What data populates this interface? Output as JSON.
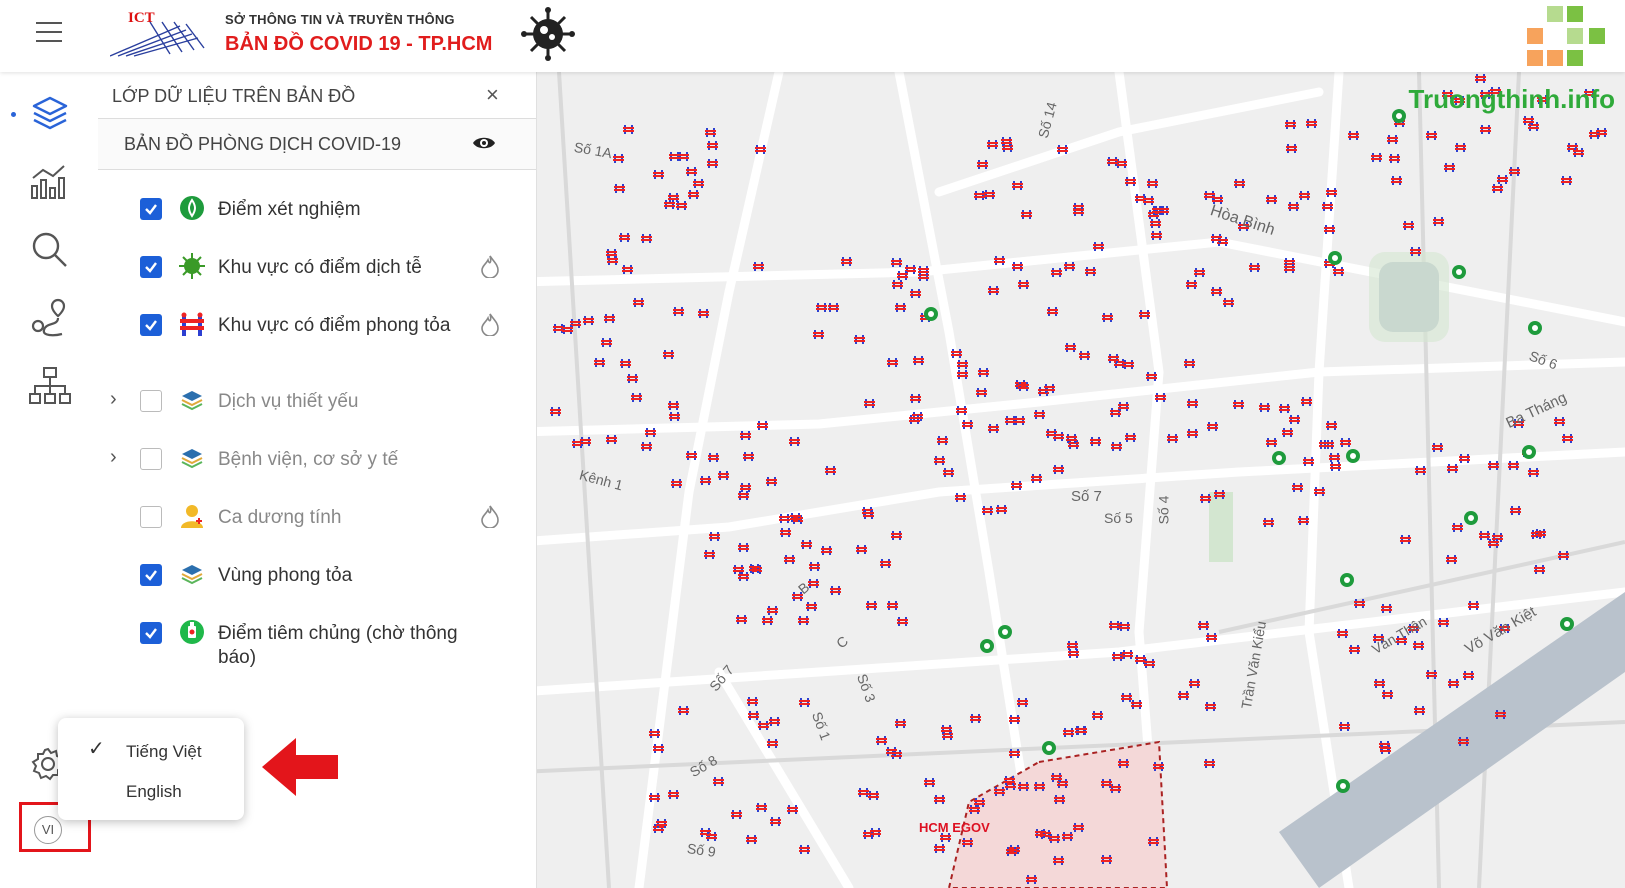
{
  "header": {
    "org": "SỞ THÔNG TIN VÀ TRUYỀN THÔNG",
    "title": "BẢN ĐỒ  COVID 19 - TP.HCM",
    "logo_text": "ICT",
    "watermark": "Truongthinh.info"
  },
  "panel": {
    "title": "LỚP DỮ LIỆU TRÊN BẢN ĐỒ",
    "close_glyph": "×",
    "group_title": "BẢN ĐỒ PHÒNG DỊCH COVID-19",
    "layers": [
      {
        "label": "Điểm xét nghiệm",
        "checked": true,
        "icon": "test-site-icon"
      },
      {
        "label": "Khu vực có điểm dịch tễ",
        "checked": true,
        "icon": "virus-icon"
      },
      {
        "label": "Khu vực có điểm phong tỏa",
        "checked": true,
        "icon": "lockdown-icon"
      },
      {
        "label": "Dịch vụ thiết yếu",
        "checked": false,
        "icon": "layers-icon"
      },
      {
        "label": "Bệnh viện, cơ sở y tế",
        "checked": false,
        "icon": "layers-icon"
      },
      {
        "label": "Ca dương tính",
        "checked": false,
        "icon": "person-icon"
      },
      {
        "label": "Vùng phong tỏa",
        "checked": true,
        "icon": "layers-icon"
      },
      {
        "label": "Điểm tiêm chủng (chờ thông báo)",
        "checked": true,
        "icon": "vaccine-icon"
      }
    ]
  },
  "language_menu": {
    "options": [
      "Tiếng Việt",
      "English"
    ],
    "selected": "Tiếng Việt",
    "current_code": "VI"
  },
  "map": {
    "street_labels": [
      "Số 1A",
      "Số 14",
      "Hòa Bình",
      "Số 6",
      "Ba Tháng",
      "Kênh 1",
      "Số 7",
      "Số 5",
      "Số 4",
      "B",
      "C",
      "Số 3",
      "Số 7",
      "Số 1",
      "Số 8",
      "Số 9",
      "Trần Văn Kiểu",
      "Văn Thân",
      "Võ Văn Kiệt"
    ],
    "badge": "HCM EGOV"
  },
  "colors": {
    "accent": "#1c5fd8",
    "title_red": "#e11d1d",
    "highlight": "#e3151b",
    "green": "#2faa3a"
  }
}
